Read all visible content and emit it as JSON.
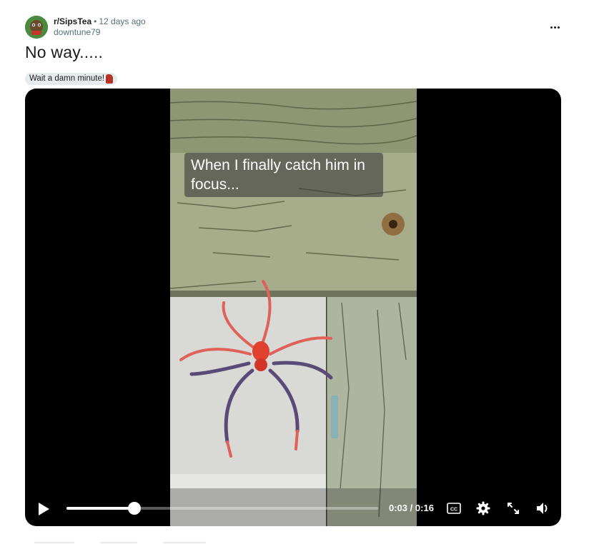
{
  "post": {
    "subreddit": "r/SipsTea",
    "separator": "•",
    "time_ago": "12 days ago",
    "author": "downtune79",
    "title": "No way.....",
    "flair_text": "Wait a damn minute!",
    "avatar_icon": "subreddit-avatar-icon",
    "more_icon": "more-options-icon"
  },
  "video": {
    "caption": "When I finally catch him in focus...",
    "current_time": "0:03",
    "time_separator": "/",
    "duration": "0:16",
    "progress_fraction": 0.2188,
    "cc_label": "CC",
    "icons": [
      "play-icon",
      "cc-icon",
      "gear-icon",
      "fullscreen-icon",
      "volume-icon"
    ]
  },
  "colors": {
    "meta_gray": "#576f76",
    "flair_bg": "#e5ebee",
    "video_bg": "#000000",
    "flair_emoji": "#b5342a"
  }
}
